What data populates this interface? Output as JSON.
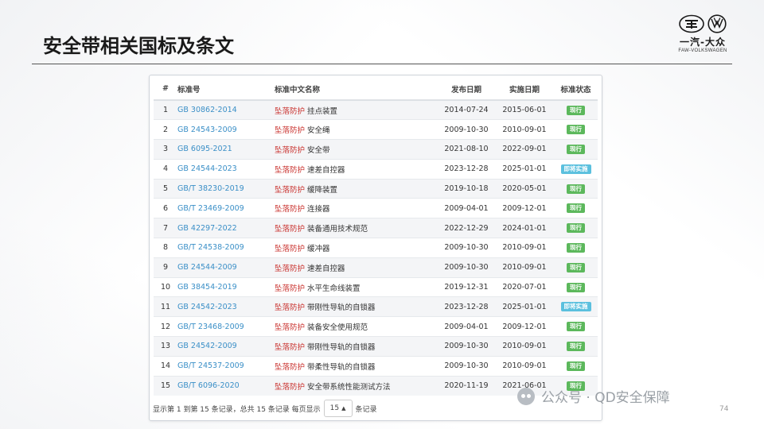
{
  "slide": {
    "title": "安全带相关国标及条文",
    "page_number": "74"
  },
  "logo": {
    "brand_cn": "一汽-大众",
    "brand_en": "FAW-VOLKSWAGEN"
  },
  "table": {
    "headers": [
      "#",
      "标准号",
      "标准中文名称",
      "发布日期",
      "实施日期",
      "标准状态"
    ],
    "keyword": "坠落防护",
    "rows": [
      {
        "num": "1",
        "code": "GB 30862-2014",
        "name": " 挂点装置",
        "pub": "2014-07-24",
        "impl": "2015-06-01",
        "status": "现行",
        "status_type": "current"
      },
      {
        "num": "2",
        "code": "GB 24543-2009",
        "name": " 安全绳",
        "pub": "2009-10-30",
        "impl": "2010-09-01",
        "status": "现行",
        "status_type": "current"
      },
      {
        "num": "3",
        "code": "GB 6095-2021",
        "name": " 安全带",
        "pub": "2021-08-10",
        "impl": "2022-09-01",
        "status": "现行",
        "status_type": "current"
      },
      {
        "num": "4",
        "code": "GB 24544-2023",
        "name": " 速差自控器",
        "pub": "2023-12-28",
        "impl": "2025-01-01",
        "status": "即将实施",
        "status_type": "upcoming"
      },
      {
        "num": "5",
        "code": "GB/T 38230-2019",
        "name": " 缓降装置",
        "pub": "2019-10-18",
        "impl": "2020-05-01",
        "status": "现行",
        "status_type": "current"
      },
      {
        "num": "6",
        "code": "GB/T 23469-2009",
        "name": " 连接器",
        "pub": "2009-04-01",
        "impl": "2009-12-01",
        "status": "现行",
        "status_type": "current"
      },
      {
        "num": "7",
        "code": "GB 42297-2022",
        "name": " 装备通用技术规范",
        "pub": "2022-12-29",
        "impl": "2024-01-01",
        "status": "现行",
        "status_type": "current"
      },
      {
        "num": "8",
        "code": "GB/T 24538-2009",
        "name": " 缓冲器",
        "pub": "2009-10-30",
        "impl": "2010-09-01",
        "status": "现行",
        "status_type": "current"
      },
      {
        "num": "9",
        "code": "GB 24544-2009",
        "name": " 速差自控器",
        "pub": "2009-10-30",
        "impl": "2010-09-01",
        "status": "现行",
        "status_type": "current"
      },
      {
        "num": "10",
        "code": "GB 38454-2019",
        "name": " 水平生命线装置",
        "pub": "2019-12-31",
        "impl": "2020-07-01",
        "status": "现行",
        "status_type": "current"
      },
      {
        "num": "11",
        "code": "GB 24542-2023",
        "name": " 带刚性导轨的自锁器",
        "pub": "2023-12-28",
        "impl": "2025-01-01",
        "status": "即将实施",
        "status_type": "upcoming"
      },
      {
        "num": "12",
        "code": "GB/T 23468-2009",
        "name": " 装备安全使用规范",
        "pub": "2009-04-01",
        "impl": "2009-12-01",
        "status": "现行",
        "status_type": "current"
      },
      {
        "num": "13",
        "code": "GB 24542-2009",
        "name": " 带刚性导轨的自锁器",
        "pub": "2009-10-30",
        "impl": "2010-09-01",
        "status": "现行",
        "status_type": "current"
      },
      {
        "num": "14",
        "code": "GB/T 24537-2009",
        "name": " 带柔性导轨的自锁器",
        "pub": "2009-10-30",
        "impl": "2010-09-01",
        "status": "现行",
        "status_type": "current"
      },
      {
        "num": "15",
        "code": "GB/T 6096-2020",
        "name": " 安全带系统性能测试方法",
        "pub": "2020-11-19",
        "impl": "2021-06-01",
        "status": "现行",
        "status_type": "current"
      }
    ]
  },
  "pagination": {
    "summary": "显示第 1 到第 15 条记录，总共 15 条记录 每页显示",
    "page_size": "15",
    "suffix": "条记录"
  },
  "watermark": {
    "text": "公众号 · QD安全保障"
  },
  "colors": {
    "current_badge": "#5cb85c",
    "upcoming_badge": "#5bc0de",
    "keyword": "#c9302c",
    "link": "#3a8fc7"
  }
}
